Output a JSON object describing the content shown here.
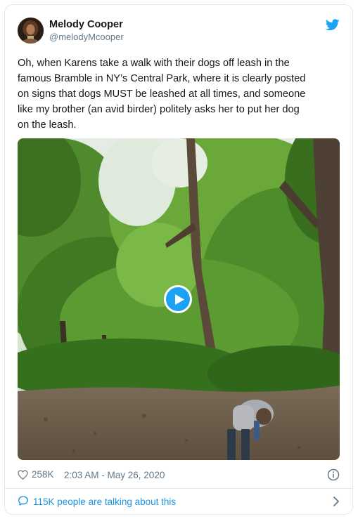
{
  "author": {
    "display_name": "Melody Cooper",
    "handle": "@melodyMcooper",
    "avatar_icon": "avatar-photo"
  },
  "tweet": {
    "text": "Oh, when Karens take a walk with their dogs off leash in the\nfamous Bramble in NY’s Central Park, where it is clearly posted\non signs that dogs MUST be leashed at all times, and someone\nlike my brother (an avid birder) politely asks her to put her dog\non the leash."
  },
  "media": {
    "type": "video",
    "play_icon": "play-icon"
  },
  "meta": {
    "likes": "258K",
    "timestamp": "2:03 AM - May 26, 2020"
  },
  "conversation": {
    "label": "115K people are talking about this"
  },
  "colors": {
    "twitter_blue": "#1da1f2",
    "link_blue": "#1b95e0",
    "muted": "#657786",
    "border": "#e1e8ed"
  }
}
